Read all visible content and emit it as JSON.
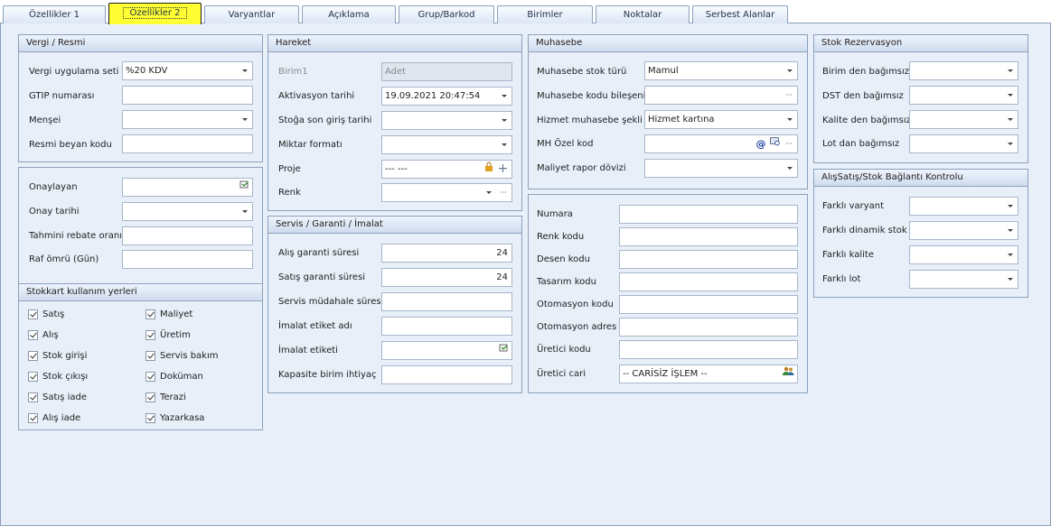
{
  "tabs": [
    "Özellikler 1",
    "Özellikler 2",
    "Varyantlar",
    "Açıklama",
    "Grup/Barkod",
    "Birimler",
    "Noktalar",
    "Serbest Alanlar"
  ],
  "vergi": {
    "title": "Vergi / Resmi",
    "uygulama_label": "Vergi uygulama seti",
    "uygulama_value": "%20 KDV",
    "gtip_label": "GTIP numarası",
    "mensei_label": "Menşei",
    "resmi_label": "Resmi beyan kodu"
  },
  "onay": {
    "onaylayan_label": "Onaylayan",
    "tarih_label": "Onay tarihi",
    "rebate_label": "Tahmini rebate oranı",
    "raf_label": "Raf ömrü (Gün)"
  },
  "stokkart": {
    "title": "Stokkart kullanım yerleri",
    "left": [
      "Satış",
      "Alış",
      "Stok girişi",
      "Stok çıkışı",
      "Satış iade",
      "Alış iade"
    ],
    "right": [
      "Maliyet",
      "Üretim",
      "Servis bakım",
      "Doküman",
      "Terazi",
      "Yazarkasa"
    ]
  },
  "hareket": {
    "title": "Hareket",
    "birim_label": "Birim1",
    "birim_value": "Adet",
    "aktivasyon_label": "Aktivasyon tarihi",
    "aktivasyon_value": "19.09.2021 20:47:54",
    "son_giris_label": "Stoğa son giriş tarihi",
    "miktar_label": "Miktar formatı",
    "proje_label": "Proje",
    "proje_value": "--- ---",
    "renk_label": "Renk"
  },
  "servis": {
    "title": "Servis / Garanti / İmalat",
    "alis_label": "Alış garanti süresi",
    "alis_value": "24",
    "satis_label": "Satış garanti süresi",
    "satis_value": "24",
    "mudahale_label": "Servis müdahale süresi",
    "etiket_adi_label": "İmalat etiket adı",
    "etiket_label": "İmalat etiketi",
    "kapasite_label": "Kapasite birim ihtiyaç"
  },
  "muhasebe": {
    "title": "Muhasebe",
    "stok_turu_label": "Muhasebe stok türü",
    "stok_turu_value": "Mamul",
    "bilesen_label": "Muhasebe kodu bileşeni",
    "hizmet_label": "Hizmet muhasebe şekli",
    "hizmet_value": "Hizmet kartına",
    "mh_label": "MH Özel kod",
    "maliyet_label": "Maliyet rapor dövizi"
  },
  "kodlar": {
    "numara_label": "Numara",
    "renk_kodu_label": "Renk kodu",
    "desen_label": "Desen kodu",
    "tasarim_label": "Tasarım kodu",
    "otomasyon_kodu_label": "Otomasyon kodu",
    "otomasyon_adres_label": "Otomasyon adres",
    "uretici_kodu_label": "Üretici kodu",
    "uretici_cari_label": "Üretici cari",
    "uretici_cari_value": "-- CARİSİZ İŞLEM --"
  },
  "rezervasyon": {
    "title": "Stok Rezervasyon",
    "birim_label": "Birim den bağımsız",
    "dst_label": "DST den bağımsız",
    "kalite_label": "Kalite den bağımsız",
    "lot_label": "Lot dan bağımsız"
  },
  "baglanti": {
    "title": "AlışSatış/Stok Bağlantı Kontrolu",
    "varyant_label": "Farklı varyant",
    "dinamik_label": "Farklı dinamik stok",
    "kalite_label": "Farklı kalite",
    "lot_label": "Farklı lot"
  },
  "colors": {
    "active_tab": "#ffff33",
    "panel_bg": "#e8eff8",
    "border": "#8ba0bc"
  }
}
